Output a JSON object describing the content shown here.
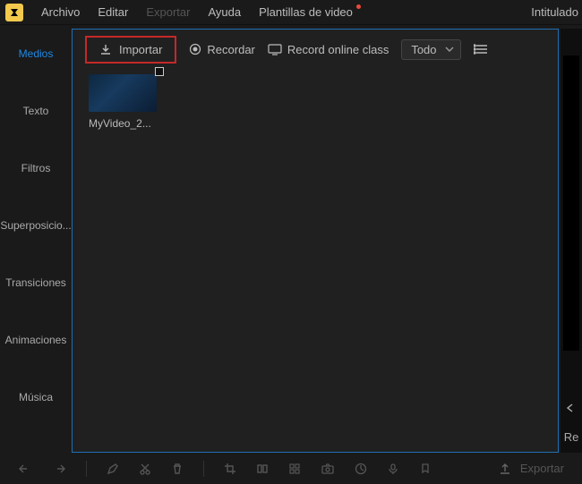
{
  "menubar": {
    "items": [
      {
        "label": "Archivo",
        "disabled": false
      },
      {
        "label": "Editar",
        "disabled": false
      },
      {
        "label": "Exportar",
        "disabled": true
      },
      {
        "label": "Ayuda",
        "disabled": false
      },
      {
        "label": "Plantillas de video",
        "disabled": false,
        "reddot": true
      }
    ],
    "project_title": "Intitulado"
  },
  "sidebar": {
    "items": [
      {
        "label": "Medios",
        "active": true
      },
      {
        "label": "Texto"
      },
      {
        "label": "Filtros"
      },
      {
        "label": "Superposicio..."
      },
      {
        "label": "Transiciones"
      },
      {
        "label": "Animaciones"
      },
      {
        "label": "Música"
      }
    ]
  },
  "toolbar_top": {
    "import_label": "Importar",
    "record_label": "Recordar",
    "record_class_label": "Record online class",
    "filter_value": "Todo"
  },
  "media": {
    "items": [
      {
        "label": "MyVideo_2..."
      }
    ]
  },
  "right": {
    "re_label": "Re"
  },
  "bottom_toolbar": {
    "export_label": "Exportar"
  }
}
